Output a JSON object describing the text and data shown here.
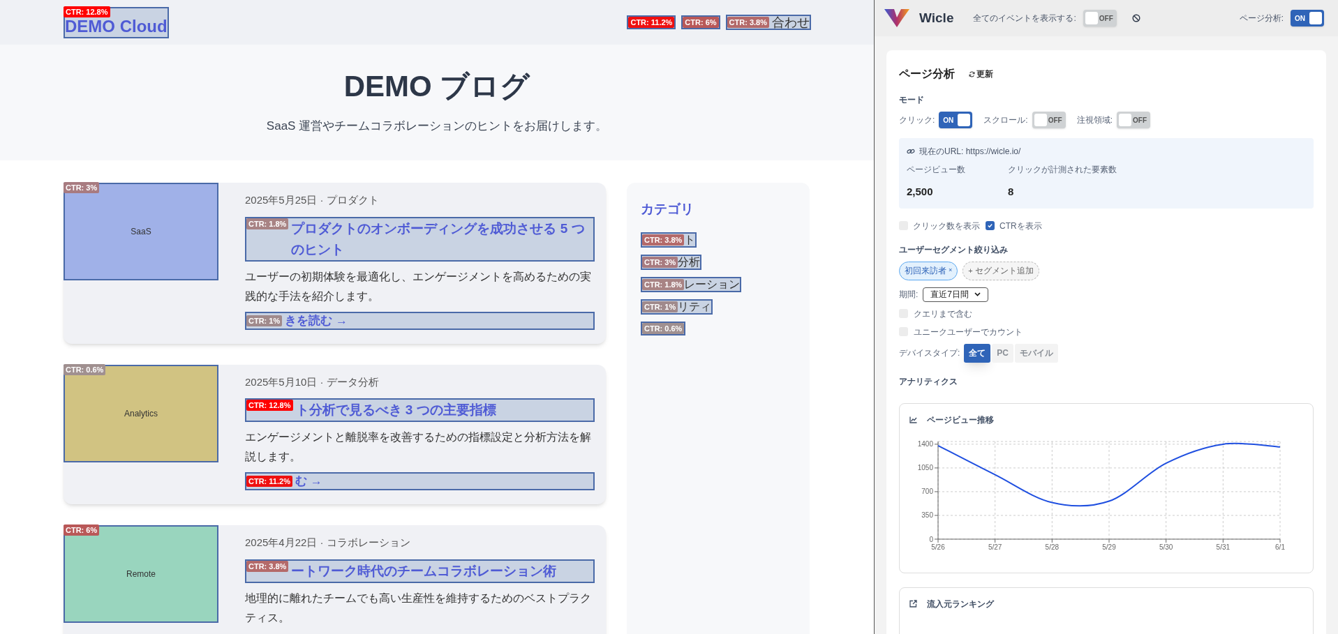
{
  "site": {
    "logo": {
      "text": "DEMO Cloud",
      "badge": {
        "text": "CTR: 12.8%",
        "color": "#ff0000"
      }
    },
    "nav": [
      {
        "badge": {
          "text": "CTR: 11.2%",
          "color": "#ef1010"
        }
      },
      {
        "badge": {
          "text": "CTR: 6%",
          "color": "#b95858"
        }
      },
      {
        "text": "合わせ",
        "badge": {
          "text": "CTR: 3.8%",
          "color": "#b46a6a"
        }
      }
    ]
  },
  "hero": {
    "title": "DEMO ブログ",
    "subtitle": "SaaS 運営やチームコラボレーションのヒントをお届けします。"
  },
  "articles": [
    {
      "image": {
        "label": "SaaS",
        "color": "#a0b1e8",
        "badge": {
          "text": "CTR: 3%",
          "color": "#a87b80"
        }
      },
      "meta": "2025年5月25日 · プロダクト",
      "title": "プロダクトのオンボーディングを成功させる 5 つのヒント",
      "title_badge": {
        "text": "CTR: 1.8%",
        "color": "#a88384"
      },
      "excerpt": "ユーザーの初期体験を最適化し、エンゲージメントを高めるための実践的な手法を紹介します。",
      "read_more": "きを読む →",
      "read_more_badge": {
        "text": "CTR: 1%",
        "color": "#a08a8c"
      }
    },
    {
      "image": {
        "label": "Analytics",
        "color": "#d1c382",
        "badge": {
          "text": "CTR: 0.6%",
          "color": "#a09090"
        }
      },
      "meta": "2025年5月10日 · データ分析",
      "title": "ト分析で見るべき 3 つの主要指標",
      "title_badge": {
        "text": "CTR: 12.8%",
        "color": "#ff0000"
      },
      "excerpt": "エンゲージメントと離脱率を改善するための指標設定と分析方法を解説します。",
      "read_more": "む →",
      "read_more_badge": {
        "text": "CTR: 11.2%",
        "color": "#ef1010"
      }
    },
    {
      "image": {
        "label": "Remote",
        "color": "#99d5be",
        "badge": {
          "text": "CTR: 6%",
          "color": "#b95858"
        }
      },
      "meta": "2025年4月22日 · コラボレーション",
      "title": "ートワーク時代のチームコラボレーション術",
      "title_badge": {
        "text": "CTR: 3.8%",
        "color": "#b46a6a"
      },
      "excerpt": "地理的に離れたチームでも高い生産性を維持するためのベストプラクティス。"
    }
  ],
  "sidebar": {
    "title": "カテゴリ",
    "categories": [
      {
        "text": "ト",
        "badge": {
          "text": "CTR: 3.8%",
          "color": "#b46a6a"
        }
      },
      {
        "text": "分析",
        "badge": {
          "text": "CTR: 3%",
          "color": "#a87b80"
        }
      },
      {
        "text": "レーション",
        "badge": {
          "text": "CTR: 1.8%",
          "color": "#a88384"
        }
      },
      {
        "text": "リティ",
        "badge": {
          "text": "CTR: 1%",
          "color": "#a08a8c"
        }
      },
      {
        "badge": {
          "text": "CTR: 0.6%",
          "color": "#a09090"
        }
      }
    ]
  },
  "panel": {
    "brand": "Wicle",
    "header_toggles": [
      {
        "label": "全てのイベントを表示する:",
        "on": false,
        "text": "OFF"
      },
      {
        "label": "ページ分析:",
        "on": true,
        "text": "ON"
      }
    ],
    "title": "ページ分析",
    "refresh": "更新",
    "mode_heading": "モード",
    "modes": [
      {
        "label": "クリック:",
        "on": true,
        "text": "ON"
      },
      {
        "label": "スクロール:",
        "on": false,
        "text": "OFF"
      },
      {
        "label": "注視領域:",
        "on": false,
        "text": "OFF"
      }
    ],
    "url": "現在のURL: https://wicle.io/",
    "stats": [
      {
        "label": "ページビュー数",
        "value": "2,500"
      },
      {
        "label": "クリックが計測された要素数",
        "value": "8"
      }
    ],
    "display_options": [
      {
        "label": "クリック数を表示",
        "checked": false
      },
      {
        "label": "CTRを表示",
        "checked": true
      }
    ],
    "segment_heading": "ユーザーセグメント絞り込み",
    "segments": [
      {
        "kind": "active",
        "label": "初回来訪者",
        "remove": "×"
      },
      {
        "kind": "add",
        "label": "セグメント追加",
        "icon": "+"
      }
    ],
    "period": {
      "label": "期間:",
      "value": "直近7日間"
    },
    "filters": [
      {
        "label": "クエリまで含む",
        "checked": false
      },
      {
        "label": "ユニークユーザーでカウント",
        "checked": false
      }
    ],
    "device": {
      "label": "デバイスタイプ:",
      "options": [
        {
          "label": "全て",
          "selected": true
        },
        {
          "label": "PC",
          "selected": false
        },
        {
          "label": "モバイル",
          "selected": false
        }
      ]
    },
    "analytics_heading": "アナリティクス",
    "pageview_card": {
      "title": "ページビュー推移",
      "chart_data": {
        "type": "line",
        "categories": [
          "5/26",
          "5/27",
          "5/28",
          "5/29",
          "5/30",
          "5/31",
          "6/1"
        ],
        "grid": true,
        "series": [
          {
            "color": "#1f4fe0",
            "values": [
              1380,
              950,
              540,
              560,
              1120,
              1400,
              1360
            ]
          }
        ],
        "ylim": [
          0,
          1440
        ],
        "yticks": [
          0,
          350,
          700,
          1050,
          1400
        ]
      }
    },
    "referrer_card": {
      "title": "流入元ランキング"
    }
  }
}
